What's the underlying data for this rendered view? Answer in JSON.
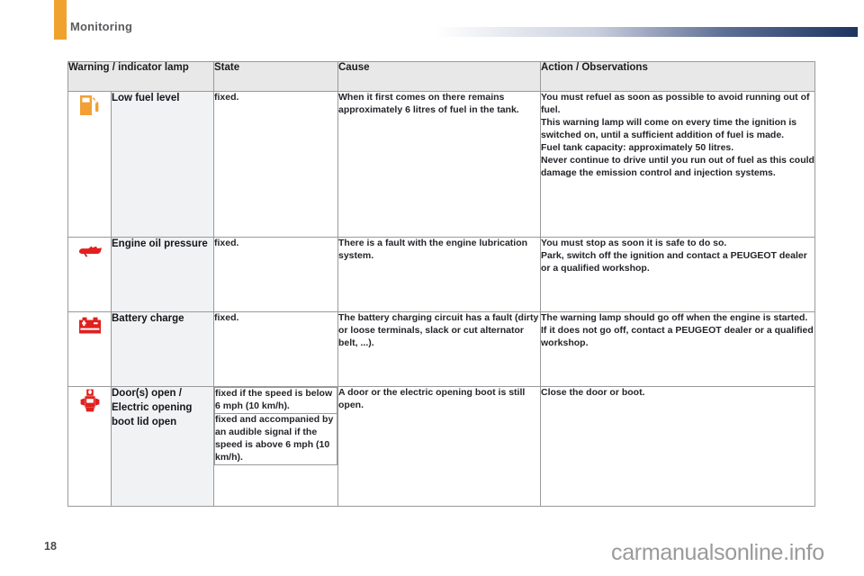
{
  "header": {
    "section_title": "Monitoring",
    "tab_color": "#f0a22e",
    "rule_end_color": "#1d3461"
  },
  "table": {
    "columns": [
      "Warning / indicator lamp",
      "State",
      "Cause",
      "Action / Observations"
    ],
    "rows": [
      {
        "icon": "fuel-pump-icon",
        "icon_color": "#f2a034",
        "name": "Low fuel level",
        "state": [
          "fixed."
        ],
        "cause": [
          "When it first comes on there remains approximately 6 litres of fuel in the tank."
        ],
        "action": [
          "You must refuel as soon as possible to avoid running out of fuel.",
          "This warning lamp will come on every time the ignition is switched on, until a sufficient addition of fuel is made.",
          "Fuel tank capacity: approximately 50 litres.",
          "Never continue to drive until you run out of fuel as this could damage the emission control and injection systems."
        ]
      },
      {
        "icon": "oil-can-icon",
        "icon_color": "#e1201e",
        "name": "Engine oil pressure",
        "state": [
          "fixed."
        ],
        "cause": [
          "There is a fault with the engine lubrication system."
        ],
        "action": [
          "You must stop as soon it is safe to do so.",
          "Park, switch off the ignition and contact a PEUGEOT dealer or a qualified workshop."
        ]
      },
      {
        "icon": "battery-icon",
        "icon_color": "#e1201e",
        "name": "Battery charge",
        "state": [
          "fixed."
        ],
        "cause": [
          "The battery charging circuit has a fault (dirty or loose terminals, slack or cut alternator belt, ...)."
        ],
        "action": [
          "The warning lamp should go off when the engine is started.",
          "If it does not go off, contact a PEUGEOT dealer or a qualified workshop."
        ]
      },
      {
        "icon": "door-open-icon",
        "icon_color": "#e1201e",
        "name": "Door(s) open / Electric opening boot lid open",
        "state": [
          "fixed if the speed is below 6 mph (10 km/h).",
          "fixed and accompanied by an audible signal if the speed is above 6 mph (10 km/h)."
        ],
        "cause": [
          "A door or the electric opening boot is still open."
        ],
        "action": [
          "Close the door or boot."
        ]
      }
    ]
  },
  "footer": {
    "page_number": "18",
    "watermark": "carmanualsonline.info"
  }
}
